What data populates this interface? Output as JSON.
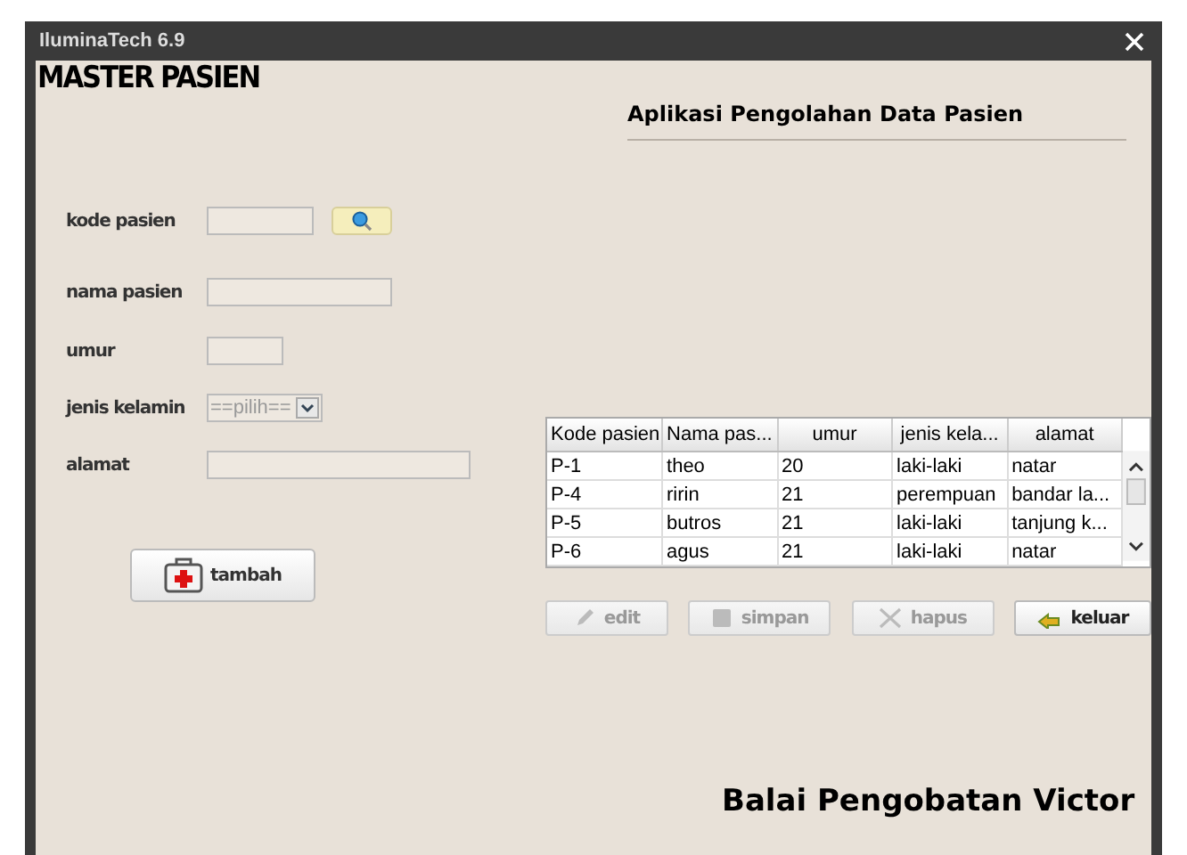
{
  "window": {
    "title": "IluminaTech 6.9"
  },
  "form_title": "MASTER PASIEN",
  "app_title": "Aplikasi Pengolahan Data Pasien",
  "fields": [
    {
      "kind": "search",
      "label": "kode pasien"
    },
    {
      "kind": "text",
      "label": "nama pasien"
    },
    {
      "kind": "short",
      "label": "umur"
    },
    {
      "kind": "select",
      "label": "jenis kelamin",
      "value": "==pilih=="
    },
    {
      "kind": "wide",
      "label": "alamat"
    }
  ],
  "add_button": {
    "label": "tambah"
  },
  "table": {
    "columns": [
      "Kode pasien",
      "Nama pas...",
      "umur",
      "jenis kela...",
      "alamat"
    ],
    "rows": [
      [
        "P-1",
        "theo",
        "20",
        "laki-laki",
        "natar"
      ],
      [
        "P-4",
        "ririn",
        "21",
        "perempuan",
        "bandar la..."
      ],
      [
        "P-5",
        "butros",
        "21",
        "laki-laki",
        "tanjung k..."
      ],
      [
        "P-6",
        "agus",
        "21",
        "laki-laki",
        "natar"
      ]
    ]
  },
  "actions": [
    {
      "kind": "edit",
      "label": "edit",
      "disabled": true
    },
    {
      "kind": "save",
      "label": "simpan",
      "disabled": true
    },
    {
      "kind": "delete",
      "label": "hapus",
      "disabled": true
    },
    {
      "kind": "exit",
      "label": "keluar",
      "disabled": false
    }
  ],
  "footer": "Balai Pengobatan Victor"
}
